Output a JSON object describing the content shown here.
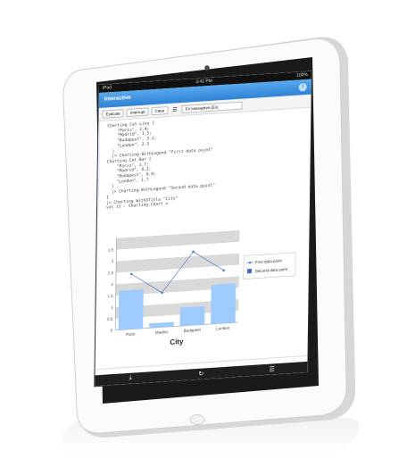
{
  "status_bar": {
    "carrier": "iPad",
    "time": "3:41 PM",
    "battery": "100%"
  },
  "app": {
    "title": "Interactive"
  },
  "toolbar": {
    "execute_label": "Execute",
    "interrupt_label": "Interrupt",
    "clear_label": "Clear",
    "mode_select_value": "F# Interactive (Ex)"
  },
  "code_lines": [
    "Charting.Cat.Line [",
    "    \"Paris\", 2.4;",
    "    \"Madrid\", 1.5;",
    "    \"Budapest\", 3.2;",
    "    \"London\", 2.3",
    "  ]",
    "  |> Charting.WithLegend \"First data point\"",
    "Charting.Cat.Bar [",
    "    \"Paris\", 1.7;",
    "    \"Madrid\", 0.2;",
    "    \"Budapest\", 0.8;",
    "    \"London\", 1.7",
    "  ]",
    "  |> Charting.WithLegend \"Second data point\"",
    "]",
    "|> Charting.WithXTitle \"City\"",
    "val it : Charting.Chart ="
  ],
  "chart_data": {
    "type": "bar",
    "categories": [
      "Paris",
      "Madrid",
      "Budapest",
      "London"
    ],
    "series": [
      {
        "name": "First data point",
        "type": "line",
        "values": [
          2.4,
          1.5,
          3.2,
          2.3
        ],
        "color": "#4a78c7"
      },
      {
        "name": "Second data point",
        "type": "bar",
        "values": [
          1.7,
          0.2,
          0.8,
          1.7
        ],
        "color": "#9ecbff"
      }
    ],
    "ylim": [
      0,
      4
    ],
    "yticks": [
      "0",
      "0.5",
      "1",
      "1.5",
      "2",
      "2.5",
      "3",
      "3.5"
    ],
    "xlabel": "City",
    "legend": "right",
    "band_color": "#d9d9d9"
  },
  "bottom_bar": {
    "icons": [
      "download-icon",
      "refresh-icon",
      "list-icon"
    ],
    "glyphs": [
      "⤓",
      "↻",
      "☰"
    ]
  }
}
